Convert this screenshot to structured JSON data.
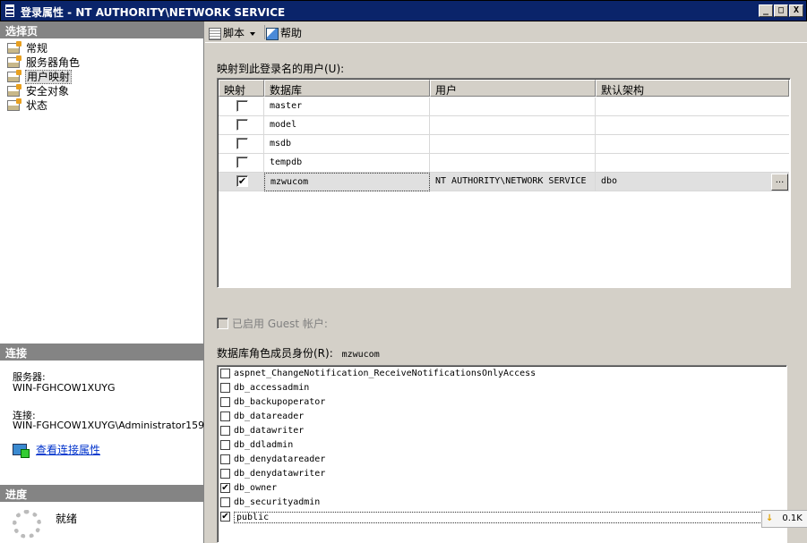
{
  "window": {
    "title": "登录属性 - NT AUTHORITY\\NETWORK SERVICE",
    "minimize_glyph": "_",
    "maximize_glyph": "□",
    "close_glyph": "X"
  },
  "sidebar": {
    "select_page_heading": "选择页",
    "items": [
      {
        "label": "常规",
        "icon": "page-icon"
      },
      {
        "label": "服务器角色",
        "icon": "page-icon"
      },
      {
        "label": "用户映射",
        "icon": "page-icon",
        "selected": true
      },
      {
        "label": "安全对象",
        "icon": "page-icon"
      },
      {
        "label": "状态",
        "icon": "page-icon"
      }
    ],
    "connection_heading": "连接",
    "server_label": "服务器:",
    "server_value": "WIN-FGHCOW1XUYG",
    "connection_label": "连接:",
    "connection_value": "WIN-FGHCOW1XUYG\\Administrator159",
    "view_connection_link": "查看连接属性",
    "progress_heading": "进度",
    "progress_status": "就绪"
  },
  "toolbar": {
    "script_label": "脚本",
    "help_label": "帮助"
  },
  "mapping": {
    "section_label": "映射到此登录名的用户(U):",
    "columns": [
      "映射",
      "数据库",
      "用户",
      "默认架构"
    ],
    "rows": [
      {
        "mapped": false,
        "database": "master",
        "user": "",
        "schema": ""
      },
      {
        "mapped": false,
        "database": "model",
        "user": "",
        "schema": ""
      },
      {
        "mapped": false,
        "database": "msdb",
        "user": "",
        "schema": ""
      },
      {
        "mapped": false,
        "database": "tempdb",
        "user": "",
        "schema": ""
      },
      {
        "mapped": true,
        "database": "mzwucom",
        "user": "NT AUTHORITY\\NETWORK SERVICE",
        "schema": "dbo",
        "selected": true
      }
    ],
    "ellipsis_label": "..."
  },
  "guest": {
    "label": "已启用 Guest 帐户:",
    "checked": false
  },
  "roles": {
    "section_label": "数据库角色成员身份(R):",
    "database": "mzwucom",
    "items": [
      {
        "name": "aspnet_ChangeNotification_ReceiveNotificationsOnlyAccess",
        "checked": false
      },
      {
        "name": "db_accessadmin",
        "checked": false
      },
      {
        "name": "db_backupoperator",
        "checked": false
      },
      {
        "name": "db_datareader",
        "checked": false
      },
      {
        "name": "db_datawriter",
        "checked": false
      },
      {
        "name": "db_ddladmin",
        "checked": false
      },
      {
        "name": "db_denydatareader",
        "checked": false
      },
      {
        "name": "db_denydatawriter",
        "checked": false
      },
      {
        "name": "db_owner",
        "checked": true
      },
      {
        "name": "db_securityadmin",
        "checked": false
      },
      {
        "name": "public",
        "checked": true,
        "focused": true
      }
    ]
  },
  "download_badge": {
    "text": "0.1K"
  },
  "check_glyph": "✔"
}
